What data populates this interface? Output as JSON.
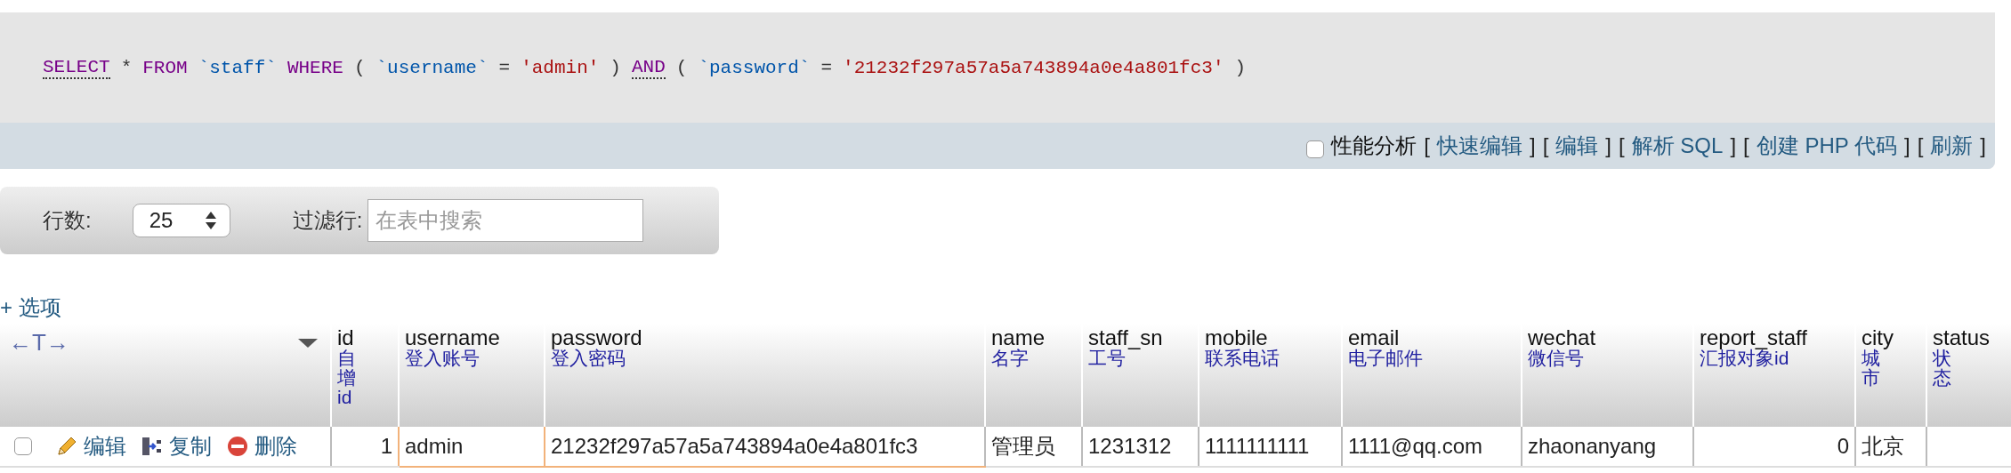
{
  "query": {
    "tokens": [
      {
        "kind": "keyword",
        "text": "SELECT",
        "linked": true
      },
      {
        "kind": "plain",
        "text": "*"
      },
      {
        "kind": "keyword",
        "text": "FROM",
        "linked": false
      },
      {
        "kind": "identifier",
        "text": "`staff`"
      },
      {
        "kind": "keyword",
        "text": "WHERE",
        "linked": false
      },
      {
        "kind": "plain",
        "text": "("
      },
      {
        "kind": "identifier",
        "text": "`username`"
      },
      {
        "kind": "plain",
        "text": "="
      },
      {
        "kind": "string",
        "text": "'admin'"
      },
      {
        "kind": "plain",
        "text": ")"
      },
      {
        "kind": "keyword",
        "text": "AND",
        "linked": true
      },
      {
        "kind": "plain",
        "text": "("
      },
      {
        "kind": "identifier",
        "text": "`password`"
      },
      {
        "kind": "plain",
        "text": "="
      },
      {
        "kind": "string",
        "text": "'21232f297a57a5a743894a0e4a801fc3'"
      },
      {
        "kind": "plain",
        "text": ")"
      }
    ]
  },
  "query_actions": {
    "profiling": {
      "label": "性能分析",
      "checked": false
    },
    "links": [
      {
        "open": "[",
        "label": "快速编辑",
        "close": "]"
      },
      {
        "open": "[",
        "label": "编辑",
        "close": "]"
      },
      {
        "open": "[",
        "label": "解析 SQL",
        "close": "]"
      },
      {
        "open": "[",
        "label": "创建 PHP 代码",
        "close": "]"
      },
      {
        "open": "[",
        "label": "刷新",
        "close": "]"
      }
    ]
  },
  "filter_bar": {
    "rows_label": "行数:",
    "rows_value": "25",
    "filter_label": "过滤行:",
    "placeholder": "在表中搜索"
  },
  "options_link": "+ 选项",
  "table": {
    "resize_label": "←T→",
    "columns": [
      {
        "name": "id",
        "comment": "自增id"
      },
      {
        "name": "username",
        "comment": "登入账号"
      },
      {
        "name": "password",
        "comment": "登入密码"
      },
      {
        "name": "name",
        "comment": "名字"
      },
      {
        "name": "staff_sn",
        "comment": "工号"
      },
      {
        "name": "mobile",
        "comment": "联系电话"
      },
      {
        "name": "email",
        "comment": "电子邮件"
      },
      {
        "name": "wechat",
        "comment": "微信号"
      },
      {
        "name": "report_staff",
        "comment": "汇报对象id"
      },
      {
        "name": "city",
        "comment": "城市"
      },
      {
        "name": "status",
        "comment": "状态"
      }
    ],
    "rows": [
      {
        "checked": false,
        "actions": [
          {
            "kind": "edit",
            "label": "编辑"
          },
          {
            "kind": "copy",
            "label": "复制"
          },
          {
            "kind": "delete",
            "label": "删除"
          }
        ],
        "cells": [
          {
            "text": "1",
            "kind": "number",
            "highlighted": false
          },
          {
            "text": "admin",
            "kind": "text",
            "highlighted": true
          },
          {
            "text": "21232f297a57a5a743894a0e4a801fc3",
            "kind": "text",
            "highlighted": true
          },
          {
            "text": "管理员",
            "kind": "text",
            "highlighted": false
          },
          {
            "text": "1231312",
            "kind": "text",
            "highlighted": false
          },
          {
            "text": "1111111111",
            "kind": "text",
            "highlighted": false
          },
          {
            "text": "1111@qq.com",
            "kind": "text",
            "highlighted": false
          },
          {
            "text": "zhaonanyang",
            "kind": "text",
            "highlighted": false
          },
          {
            "text": "0",
            "kind": "number",
            "highlighted": false
          },
          {
            "text": "北京",
            "kind": "text",
            "highlighted": false
          },
          {
            "kind": "empty",
            "highlighted": false
          }
        ]
      }
    ]
  }
}
